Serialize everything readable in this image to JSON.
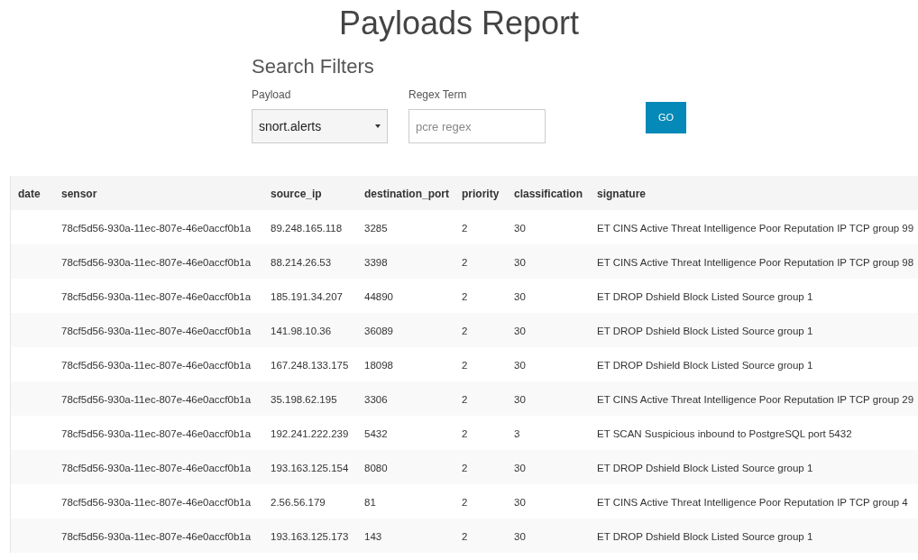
{
  "title": "Payloads Report",
  "filters": {
    "heading": "Search Filters",
    "payload": {
      "label": "Payload",
      "value": "snort.alerts"
    },
    "regex": {
      "label": "Regex Term",
      "placeholder": "pcre regex"
    },
    "button": "GO"
  },
  "table": {
    "columns": [
      "date",
      "sensor",
      "source_ip",
      "destination_port",
      "priority",
      "classification",
      "signature"
    ],
    "rows": [
      [
        "",
        "78cf5d56-930a-11ec-807e-46e0accf0b1a",
        "89.248.165.118",
        "3285",
        "2",
        "30",
        "ET CINS Active Threat Intelligence Poor Reputation IP TCP group 99"
      ],
      [
        "",
        "78cf5d56-930a-11ec-807e-46e0accf0b1a",
        "88.214.26.53",
        "3398",
        "2",
        "30",
        "ET CINS Active Threat Intelligence Poor Reputation IP TCP group 98"
      ],
      [
        "",
        "78cf5d56-930a-11ec-807e-46e0accf0b1a",
        "185.191.34.207",
        "44890",
        "2",
        "30",
        "ET DROP Dshield Block Listed Source group 1"
      ],
      [
        "",
        "78cf5d56-930a-11ec-807e-46e0accf0b1a",
        "141.98.10.36",
        "36089",
        "2",
        "30",
        "ET DROP Dshield Block Listed Source group 1"
      ],
      [
        "",
        "78cf5d56-930a-11ec-807e-46e0accf0b1a",
        "167.248.133.175",
        "18098",
        "2",
        "30",
        "ET DROP Dshield Block Listed Source group 1"
      ],
      [
        "",
        "78cf5d56-930a-11ec-807e-46e0accf0b1a",
        "35.198.62.195",
        "3306",
        "2",
        "30",
        "ET CINS Active Threat Intelligence Poor Reputation IP TCP group 29"
      ],
      [
        "",
        "78cf5d56-930a-11ec-807e-46e0accf0b1a",
        "192.241.222.239",
        "5432",
        "2",
        "3",
        "ET SCAN Suspicious inbound to PostgreSQL port 5432"
      ],
      [
        "",
        "78cf5d56-930a-11ec-807e-46e0accf0b1a",
        "193.163.125.154",
        "8080",
        "2",
        "30",
        "ET DROP Dshield Block Listed Source group 1"
      ],
      [
        "",
        "78cf5d56-930a-11ec-807e-46e0accf0b1a",
        "2.56.56.179",
        "81",
        "2",
        "30",
        "ET CINS Active Threat Intelligence Poor Reputation IP TCP group 4"
      ],
      [
        "",
        "78cf5d56-930a-11ec-807e-46e0accf0b1a",
        "193.163.125.173",
        "143",
        "2",
        "30",
        "ET DROP Dshield Block Listed Source group 1"
      ]
    ]
  }
}
